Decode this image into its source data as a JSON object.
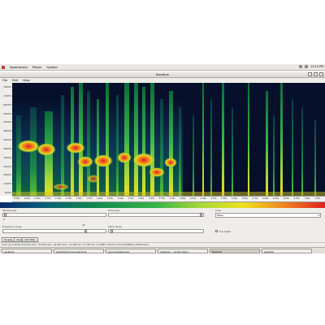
{
  "top_panel": {
    "menus": [
      "Applications",
      "Places",
      "System"
    ],
    "clock": "12:13 PM"
  },
  "window": {
    "title": "Baudline"
  },
  "menubar": [
    "File",
    "Edit",
    "View"
  ],
  "y_axis_ticks": [
    "7800Hz",
    "7200Hz",
    "6600Hz",
    "6000Hz",
    "5400Hz",
    "4800Hz",
    "4200Hz",
    "3600Hz",
    "3000Hz",
    "2400Hz",
    "1800Hz",
    "1200Hz",
    "600Hz"
  ],
  "x_axis_ticks": [
    "0.00s",
    "0.25s",
    "0.50s",
    "0.75s",
    "1.00s",
    "1.25s",
    "1.50s",
    "1.75s",
    "2.00s",
    "2.25s",
    "2.50s",
    "2.75s",
    "3.00s",
    "3.25s",
    "3.50s",
    "3.75s",
    "4.00s",
    "4.25s",
    "4.50s",
    "4.75s",
    "5.00s",
    "5.25s",
    "5.50s",
    "5.75s",
    "6.00s",
    "6.25s",
    "6.50s",
    "6.75s",
    "7.00s",
    "7.25s"
  ],
  "controls": {
    "window_size_label": "Window size",
    "window_size_value": "8",
    "time_span_label": "Time span",
    "color_label": "Color",
    "color_value": "Mixer",
    "frequency_range_label": "Frequency range",
    "frequency_range_value": "40",
    "value_range_label": "Value range",
    "full_depth_label": "Full depth",
    "buttons": [
      "Display",
      "View",
      "Add filter"
    ]
  },
  "status_text": "Audio (pcm 44100 Hz 16 bit) max: -75.0dB mean: -94.0dB mean: -53.4dB min: -57.5dB rms: 3.3 SNRS: 78,672 (1.00 09_20080404_000000.wav)",
  "taskbar": [
    {
      "label": "parabolic",
      "active": false
    },
    {
      "label": "spectrogram.sca.spectrum",
      "active": false
    },
    {
      "label": "sonicvisualiser.exe",
      "active": false
    },
    {
      "label": "parabolic — audio player",
      "active": false
    },
    {
      "label": "Baudline",
      "active": true
    },
    {
      "label": "Audacity",
      "active": false
    }
  ],
  "colors": {
    "background": "#06102a",
    "accent_hot": "#e02020",
    "accent_mid": "#39b54a"
  }
}
